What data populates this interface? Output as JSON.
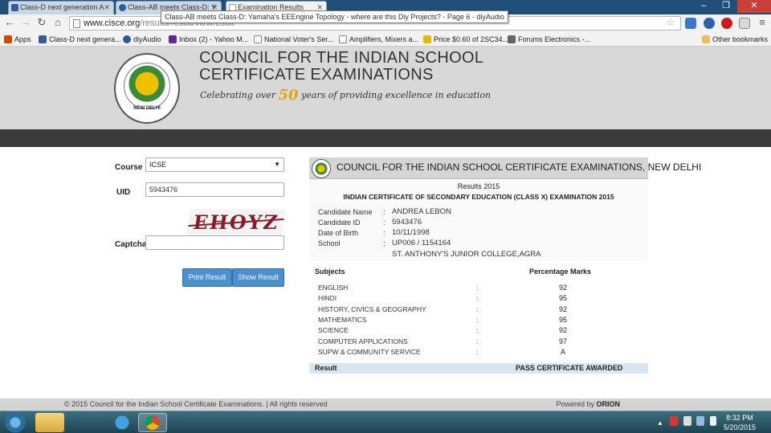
{
  "browser": {
    "tabs": [
      {
        "label": "Class-D next generation A",
        "icon_color": "#3b5998"
      },
      {
        "label": "Class-AB meets Class-D: Y",
        "icon_color": "#2a5aa0"
      },
      {
        "label": "Examination Results",
        "icon_color": "#ffffff"
      }
    ],
    "tooltip": "Class-AB meets Class-D: Yamaha's EEEngine Topology - where are this Diy Projects? - Page 6 - diyAudio",
    "url_host": "www.cisce.org",
    "url_path": "/results/result/viewresult",
    "bookmarks": [
      {
        "label": "Apps",
        "icon_color": "#d04a02"
      },
      {
        "label": "Class-D next genera...",
        "icon_color": "#3b5998"
      },
      {
        "label": "diyAudio",
        "icon_color": "#2a5aa0"
      },
      {
        "label": "Inbox (2) - Yahoo M...",
        "icon_color": "#5c2d91"
      },
      {
        "label": "National Voter's Ser...",
        "icon_color": "#eeeeee"
      },
      {
        "label": "Amplifiers, Mixers a...",
        "icon_color": "#eeeeee"
      },
      {
        "label": "Price $0.60 of 2SC34...",
        "icon_color": "#e6b800"
      },
      {
        "label": "Forums Electronics -...",
        "icon_color": "#666666"
      }
    ],
    "other_bookmarks": "Other bookmarks"
  },
  "header": {
    "org_title": "COUNCIL FOR THE INDIAN SCHOOL CERTIFICATE EXAMINATIONS",
    "tagline_pre": "Celebrating over ",
    "tagline_num": "50",
    "tagline_post": " years of providing excellence in education",
    "seal_text": "NEW DELHI"
  },
  "form": {
    "course_label": "Course",
    "course_value": "ICSE",
    "uid_label": "UID",
    "uid_value": "5943476",
    "captcha_text": "EHOYZ",
    "captcha_label": "Captcha",
    "captcha_value": "",
    "print_button": "Print Result",
    "show_button": "Show Result"
  },
  "result": {
    "header": "COUNCIL FOR THE INDIAN SCHOOL CERTIFICATE EXAMINATIONS, NEW DELHI",
    "results_year": "Results 2015",
    "exam_title": "INDIAN CERTIFICATE OF SECONDARY EDUCATION (CLASS X) EXAMINATION 2015",
    "candidate": {
      "name_label": "Candidate Name",
      "name": "ANDREA LEBON",
      "id_label": "Candidate ID",
      "id": "5943476",
      "dob_label": "Date of Birth",
      "dob": "10/11/1998",
      "school_label": "School",
      "school_code": "UP006 / 1154164",
      "school_name": "ST. ANTHONY'S JUNIOR COLLEGE,AGRA"
    },
    "subjects_header": "Subjects",
    "marks_header": "Percentage Marks",
    "subjects": [
      {
        "name": "ENGLISH",
        "mark": "92"
      },
      {
        "name": "HINDI",
        "mark": "95"
      },
      {
        "name": "HISTORY, CIVICS & GEOGRAPHY",
        "mark": "92"
      },
      {
        "name": "MATHEMATICS",
        "mark": "95"
      },
      {
        "name": "SCIENCE",
        "mark": "92"
      },
      {
        "name": "COMPUTER APPLICATIONS",
        "mark": "97"
      },
      {
        "name": "SUPW & COMMUNITY SERVICE",
        "mark": "A"
      }
    ],
    "result_label": "Result",
    "result_value": "PASS CERTIFICATE AWARDED"
  },
  "footer": {
    "copyright": "© 2015 Council for the Indian School Certificate Examinations. | All rights reserved",
    "powered_pre": "Powered by ",
    "powered_brand": "ORION"
  },
  "taskbar": {
    "time": "8:32 PM",
    "date": "5/20/2015"
  }
}
